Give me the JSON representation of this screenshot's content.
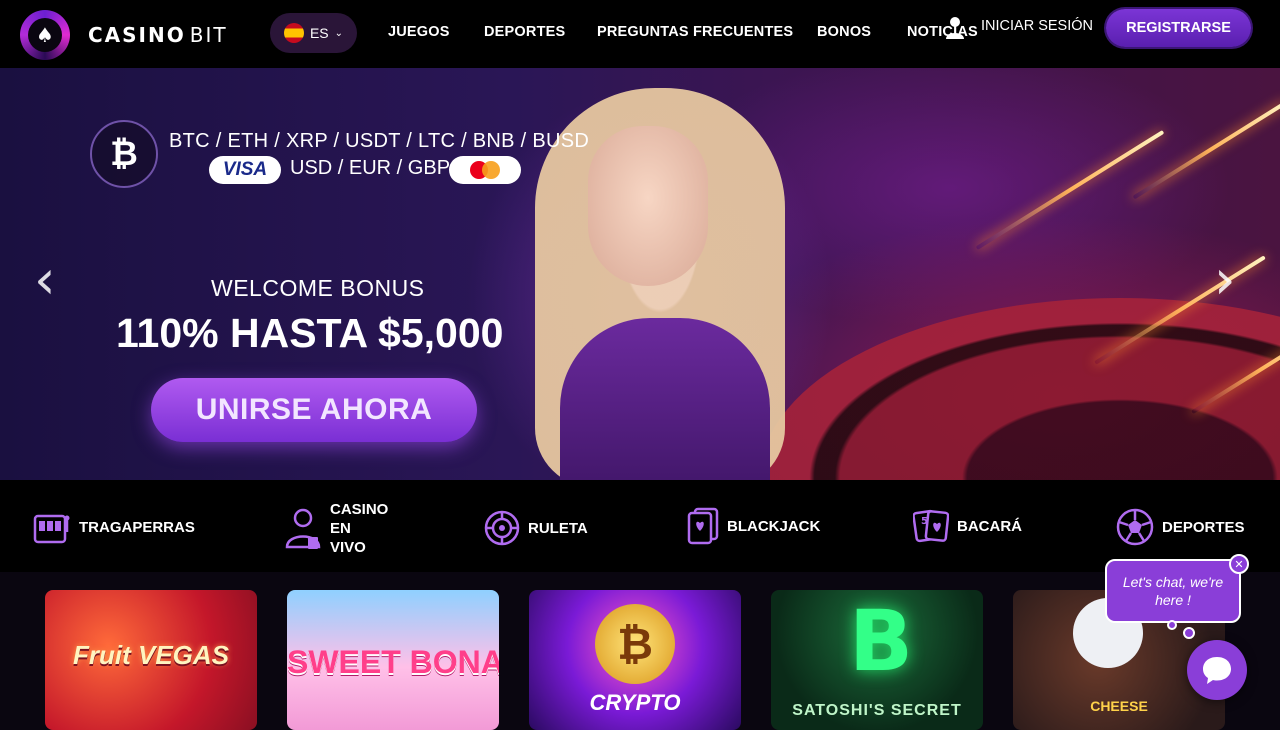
{
  "header": {
    "brand": {
      "name": "CASINO",
      "suffix": "BIT"
    },
    "language": {
      "code": "ES"
    },
    "nav": [
      {
        "label": "JUEGOS"
      },
      {
        "label": "DEPORTES"
      },
      {
        "label": "PREGUNTAS FRECUENTES"
      },
      {
        "label": "BONOS"
      },
      {
        "label": "NOTICIAS"
      }
    ],
    "login_label": "INICIAR SESIÓN",
    "register_label": "REGISTRARSE"
  },
  "hero": {
    "crypto_symbol": "₿",
    "crypto_list": "BTC / ETH / XRP / USDT / LTC / BNB / BUSD",
    "visa_label": "VISA",
    "fiat_list": "USD / EUR / GBP",
    "welcome": "WELCOME BONUS",
    "bonus": "110% HASTA $5,000",
    "cta_label": "UNIRSE AHORA",
    "prev_icon": "chevron-left-icon",
    "next_icon": "chevron-right-icon"
  },
  "categories": [
    {
      "label": "TRAGAPERRAS",
      "icon": "slot-machine-icon"
    },
    {
      "label": "CASINO\nEN\nVIVO",
      "icon": "live-dealer-icon"
    },
    {
      "label": "RULETA",
      "icon": "roulette-icon"
    },
    {
      "label": "BLACKJACK",
      "icon": "cards-icon"
    },
    {
      "label": "BACARÁ",
      "icon": "baccarat-cards-icon"
    },
    {
      "label": "DEPORTES",
      "icon": "soccer-ball-icon"
    }
  ],
  "games": [
    {
      "title": "Fruit VEGAS"
    },
    {
      "title": "SWEET BONANZA"
    },
    {
      "title": "CRYPTO"
    },
    {
      "title": "SATOSHI'S SECRET",
      "symbol": "B"
    },
    {
      "title": "CHEESE"
    }
  ],
  "chat": {
    "message": "Let's chat, we're here !",
    "close_symbol": "✕"
  },
  "colors": {
    "accent": "#7b35d6",
    "chat": "#8a3ed8",
    "background": "#000000"
  }
}
